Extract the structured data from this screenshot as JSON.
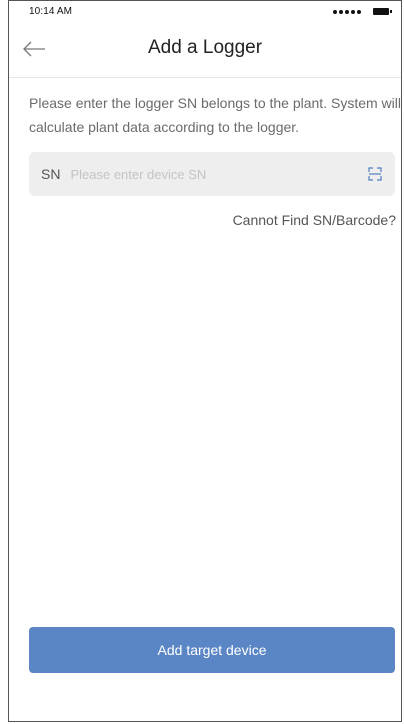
{
  "status_bar": {
    "time": "10:14 AM",
    "signal_icon": "signal-dots-icon",
    "battery_icon": "battery-icon"
  },
  "header": {
    "back_icon": "arrow-left-icon",
    "title": "Add a Logger"
  },
  "description": "Please enter the logger SN belongs to the plant. System will calculate plant data according to the logger.",
  "sn_field": {
    "label": "SN",
    "placeholder": "Please enter device SN",
    "value": "",
    "scan_icon": "scan-icon"
  },
  "help_link": "Cannot Find SN/Barcode?",
  "primary_button": {
    "label": "Add target device"
  },
  "colors": {
    "accent": "#5a86c5",
    "input_bg": "#eeeeee",
    "scan_icon": "#4f7fc2",
    "text_secondary": "#6b6b6b"
  }
}
